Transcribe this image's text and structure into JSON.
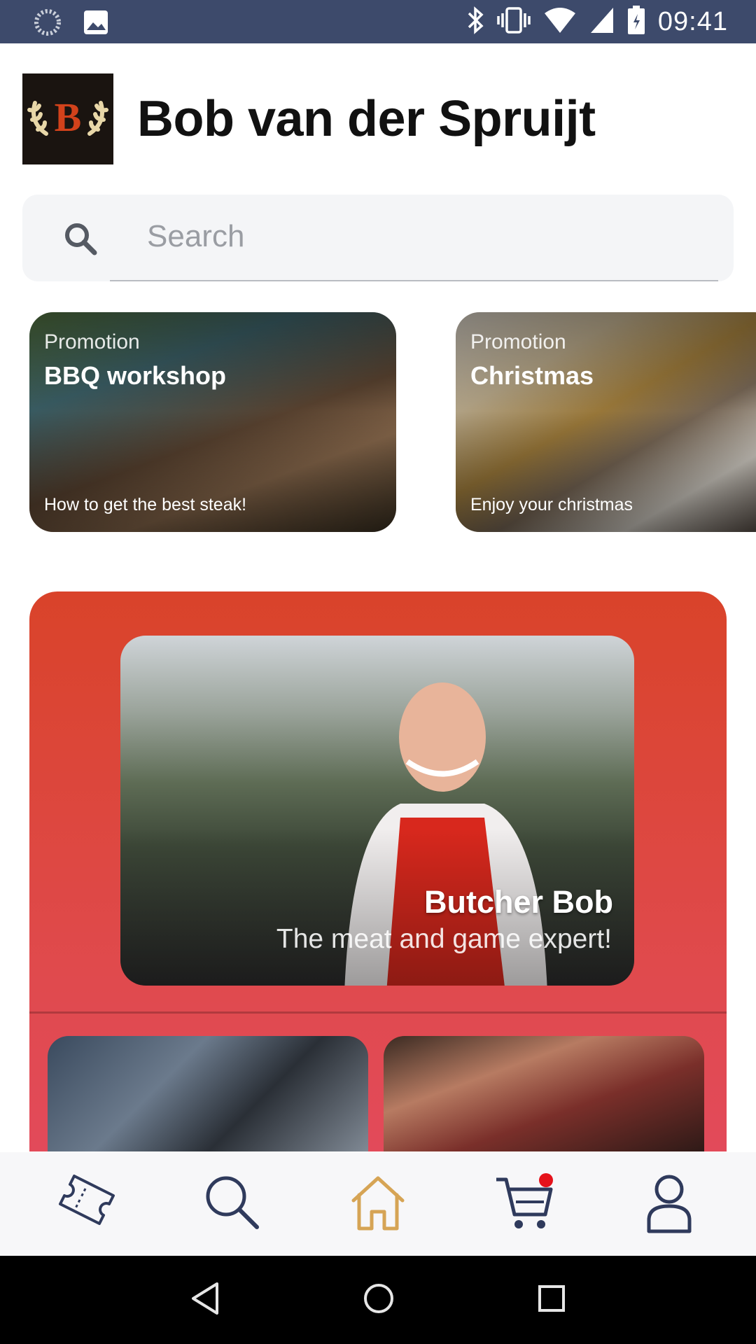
{
  "status_bar": {
    "time": "09:41",
    "icons": [
      "loading-icon",
      "image-icon",
      "bluetooth-icon",
      "vibrate-icon",
      "wifi-icon",
      "signal-icon",
      "battery-icon"
    ]
  },
  "header": {
    "logo_letter": "B",
    "title": "Bob van der Spruijt"
  },
  "search": {
    "placeholder": "Search"
  },
  "promotions": [
    {
      "label": "Promotion",
      "title": "BBQ workshop",
      "subtitle": "How to get the best steak!"
    },
    {
      "label": "Promotion",
      "title": "Christmas",
      "subtitle": "Enjoy your christmas"
    }
  ],
  "feature": {
    "title": "Butcher Bob",
    "subtitle": "The meat and game expert!"
  },
  "bottom_nav": {
    "items": [
      "ticket-icon",
      "search-icon",
      "home-icon",
      "cart-icon",
      "profile-icon"
    ],
    "active": "home-icon",
    "cart_badge": true
  },
  "colors": {
    "status_bar": "#3d4a6b",
    "accent_red": "#d9432a",
    "nav_icon": "#2f3a5c",
    "nav_active": "#d6a455",
    "badge": "#e5121b"
  }
}
